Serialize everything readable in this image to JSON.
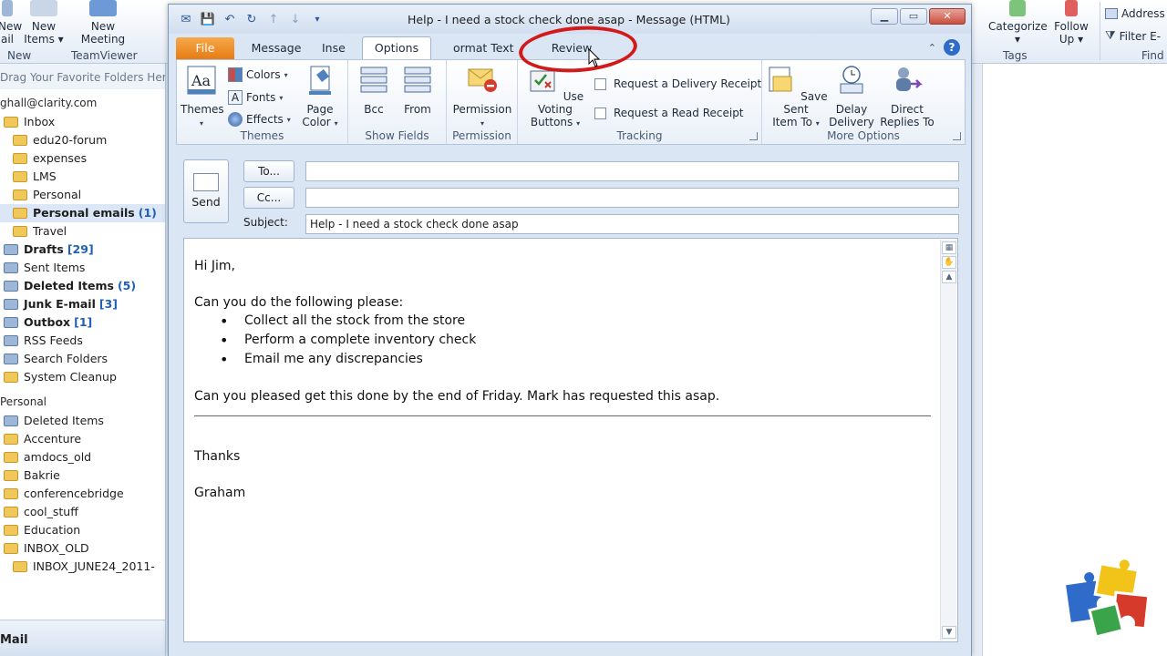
{
  "background_window": {
    "ribbon_buttons": [
      {
        "label": "New\nEmail",
        "short": "ail"
      },
      {
        "label": "New\nItems",
        "short": "Items ▾"
      },
      {
        "label": "New\nMeeting",
        "short": "Meeting"
      }
    ],
    "new_label": "New",
    "teamviewer_label": "TeamViewer",
    "new_email_top": "New",
    "new_email_bottom": "ail",
    "new_items_top": "New",
    "new_items_bottom": "Items ▾",
    "new_meeting_top": "New",
    "new_meeting_bottom": "Meeting",
    "categorize_label": "Categorize",
    "categorize_arrow": "▾",
    "follow_up_top": "Follow",
    "follow_up_bottom": "Up ▾",
    "tags_label": "Tags",
    "address_book_label": "Address",
    "filter_email_label": "Filter E-",
    "find_label": "Find",
    "fav_hint": "Drag Your Favorite Folders Here",
    "account": "ghall@clarity.com",
    "folders": [
      {
        "name": "Inbox",
        "count": "",
        "indent": 0,
        "bold": false,
        "special": false
      },
      {
        "name": "edu20-forum",
        "count": "",
        "indent": 1,
        "bold": false,
        "special": false
      },
      {
        "name": "expenses",
        "count": "",
        "indent": 1,
        "bold": false,
        "special": false
      },
      {
        "name": "LMS",
        "count": "",
        "indent": 1,
        "bold": false,
        "special": false
      },
      {
        "name": "Personal",
        "count": "",
        "indent": 1,
        "bold": false,
        "special": false
      },
      {
        "name": "Personal emails",
        "count": "(1)",
        "indent": 1,
        "bold": true,
        "special": false
      },
      {
        "name": "Travel",
        "count": "",
        "indent": 1,
        "bold": false,
        "special": false
      },
      {
        "name": "Drafts",
        "count": "[29]",
        "indent": 0,
        "bold": true,
        "special": true
      },
      {
        "name": "Sent Items",
        "count": "",
        "indent": 0,
        "bold": false,
        "special": true
      },
      {
        "name": "Deleted Items",
        "count": "(5)",
        "indent": 0,
        "bold": true,
        "special": true
      },
      {
        "name": "Junk E-mail",
        "count": "[3]",
        "indent": 0,
        "bold": true,
        "special": true
      },
      {
        "name": "Outbox",
        "count": "[1]",
        "indent": 0,
        "bold": true,
        "special": true
      },
      {
        "name": "RSS Feeds",
        "count": "",
        "indent": 0,
        "bold": false,
        "special": true
      },
      {
        "name": "Search Folders",
        "count": "",
        "indent": 0,
        "bold": false,
        "special": true
      },
      {
        "name": "System Cleanup",
        "count": "",
        "indent": 0,
        "bold": false,
        "special": false
      }
    ],
    "personal_section": "Personal",
    "personal_folders": [
      {
        "name": "Deleted Items",
        "indent": 0,
        "special": true
      },
      {
        "name": "Accenture",
        "indent": 0,
        "special": false
      },
      {
        "name": "amdocs_old",
        "indent": 0,
        "special": false
      },
      {
        "name": "Bakrie",
        "indent": 0,
        "special": false
      },
      {
        "name": "conferencebridge",
        "indent": 0,
        "special": false
      },
      {
        "name": "cool_stuff",
        "indent": 0,
        "special": false
      },
      {
        "name": "Education",
        "indent": 0,
        "special": false
      },
      {
        "name": "INBOX_OLD",
        "indent": 0,
        "special": false
      },
      {
        "name": "INBOX_JUNE24_2011-",
        "indent": 1,
        "special": false
      }
    ],
    "mail_label": "Mail"
  },
  "window": {
    "title": "Help - I need a stock check done asap  -  Message (HTML)"
  },
  "tabs": {
    "file": "File",
    "message": "Message",
    "insert": "Inse",
    "options": "Options",
    "format_text": "ormat Text",
    "review": "Review"
  },
  "ribbon": {
    "themes": {
      "label": "Themes",
      "button": "Themes",
      "colors": "Colors",
      "fonts": "Fonts",
      "effects": "Effects",
      "page_color": "Page\nColor",
      "page_color_top": "Page",
      "page_color_bottom": "Color"
    },
    "show_fields": {
      "label": "Show Fields",
      "bcc": "Bcc",
      "from": "From"
    },
    "permission": {
      "label": "Permission",
      "button": "Permission"
    },
    "tracking": {
      "label": "Tracking",
      "voting_top": "Use Voting",
      "voting_bottom": "Buttons",
      "delivery_receipt": "Request a Delivery Receipt",
      "read_receipt": "Request a Read Receipt"
    },
    "more_options": {
      "label": "More Options",
      "save_sent_top": "Save Sent",
      "save_sent_bottom": "Item To",
      "delay_top": "Delay",
      "delay_bottom": "Delivery",
      "direct_top": "Direct",
      "direct_bottom": "Replies To"
    }
  },
  "compose": {
    "send": "Send",
    "to_button": "To...",
    "cc_button": "Cc...",
    "to_value": "",
    "cc_value": "",
    "subject_label": "Subject:",
    "subject_value": "Help - I need a stock check done asap"
  },
  "body": {
    "greeting": "Hi Jim,",
    "intro": "Can you do the following please:",
    "bullets": [
      "Collect all the stock from the store",
      "Perform a complete inventory check",
      "Email me any discrepancies"
    ],
    "request": "Can you pleased get this done by the end of Friday. Mark has requested this asap.",
    "thanks": "Thanks",
    "signature": "Graham"
  },
  "colors": {
    "file_tab": "#e77b14",
    "annotation": "#d31a1a",
    "link_count": "#1f5fb4"
  }
}
